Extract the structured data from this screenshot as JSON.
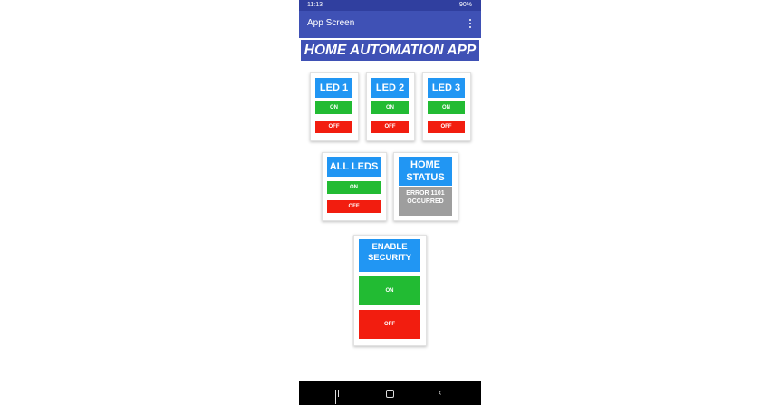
{
  "status_bar": {
    "time": "11:13",
    "right": "90%"
  },
  "app_bar": {
    "title": "App Screen"
  },
  "banner": "HOME AUTOMATION APP",
  "led_cards": [
    {
      "title": "LED 1",
      "on": "ON",
      "off": "OFF"
    },
    {
      "title": "LED 2",
      "on": "ON",
      "off": "OFF"
    },
    {
      "title": "LED 3",
      "on": "ON",
      "off": "OFF"
    }
  ],
  "all_leds": {
    "title": "ALL LEDS",
    "on": "ON",
    "off": "OFF"
  },
  "home_status": {
    "title_line1": "HOME",
    "title_line2": "STATUS",
    "message_line1": "ERROR 1101",
    "message_line2": "OCCURRED"
  },
  "security": {
    "title_line1": "ENABLE",
    "title_line2": "SECURITY",
    "on": "ON",
    "off": "OFF"
  },
  "colors": {
    "primary_dark": "#303f9f",
    "primary": "#3f51b5",
    "header_blue": "#2196f3",
    "on_green": "#22bb33",
    "off_red": "#f21d0f",
    "status_gray": "#9e9e9e"
  },
  "icons": [
    "overflow-menu-icon",
    "recent-apps-icon",
    "home-icon",
    "back-icon"
  ]
}
